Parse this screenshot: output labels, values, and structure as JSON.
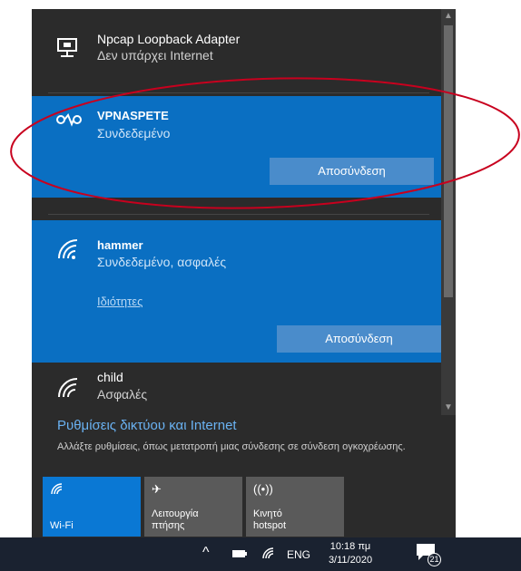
{
  "networks": [
    {
      "name": "Npcap Loopback Adapter",
      "status": "Δεν υπάρχει Internet",
      "icon": "ethernet-icon"
    },
    {
      "name": "VPNASPETE",
      "status": "Συνδεδεμένο",
      "icon": "vpn-icon",
      "button": "Αποσύνδεση"
    },
    {
      "name": "hammer",
      "status": "Συνδεδεμένο, ασφαλές",
      "icon": "wifi-icon",
      "link": "Ιδιότητες",
      "button": "Αποσύνδεση"
    },
    {
      "name": "child",
      "status": "Ασφαλές",
      "icon": "wifi-icon"
    }
  ],
  "settings": {
    "title": "Ρυθμίσεις δικτύου και Internet",
    "description": "Αλλάξτε ρυθμίσεις, όπως μετατροπή μιας σύνδεσης σε σύνδεση ογκοχρέωσης."
  },
  "tiles": [
    {
      "label": "Wi-Fi",
      "icon": "wifi-icon",
      "active": true
    },
    {
      "label": "Λειτουργία πτήσης",
      "icon": "airplane-icon",
      "active": false
    },
    {
      "label": "Κινητό hotspot",
      "icon": "hotspot-icon",
      "active": false
    }
  ],
  "taskbar": {
    "language": "ENG",
    "time": "10:18 πμ",
    "date": "3/11/2020",
    "notification_count": "21"
  },
  "colors": {
    "flyout_bg": "#2b2b2b",
    "selected_bg": "#0a6fc2",
    "accent": "#0a78d4",
    "link": "#6ab2f2",
    "annotation": "#c8001e"
  }
}
